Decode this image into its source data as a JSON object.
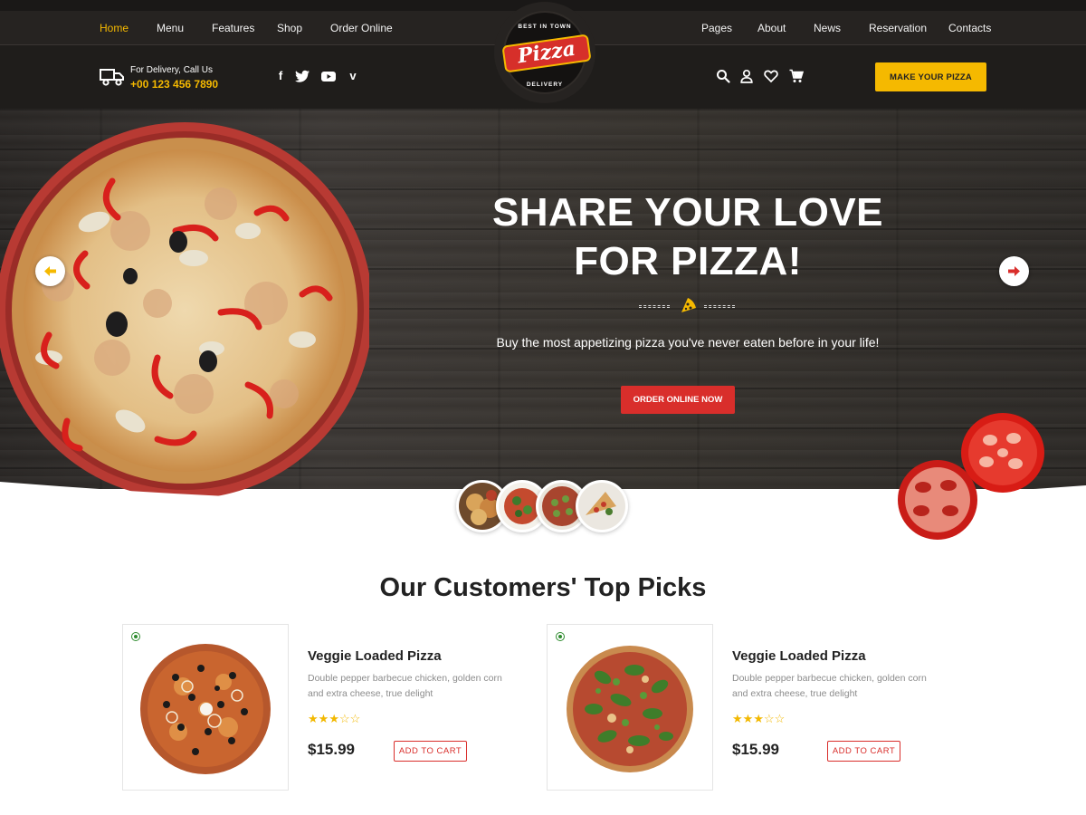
{
  "nav": {
    "left": [
      "Home",
      "Menu",
      "Features",
      "Shop",
      "Order Online"
    ],
    "right": [
      "Pages",
      "About",
      "News",
      "Reservation",
      "Contacts"
    ],
    "active": "Home"
  },
  "logo": {
    "top_text": "BEST IN TOWN",
    "word": "Pizza",
    "bottom_text": "DELIVERY"
  },
  "delivery": {
    "label": "For Delivery, Call Us",
    "phone": "+00 123 456 7890"
  },
  "social_icons": [
    "facebook-icon",
    "twitter-icon",
    "youtube-icon",
    "vimeo-icon"
  ],
  "header_icons": [
    "search-icon",
    "user-icon",
    "heart-icon",
    "cart-icon"
  ],
  "make_button": "MAKE YOUR PIZZA",
  "hero": {
    "title_line1": "SHARE YOUR LOVE",
    "title_line2": "FOR PIZZA!",
    "subtitle": "Buy the most appetizing pizza you've never eaten before in your life!",
    "button": "ORDER ONLINE NOW"
  },
  "section": {
    "title": "Our Customers' Top Picks"
  },
  "products": [
    {
      "name": "Veggie Loaded Pizza",
      "description": "Double pepper barbecue chicken, golden corn and extra cheese, true delight",
      "rating": 3,
      "rating_max": 5,
      "price": "$15.99",
      "button": "ADD TO CART"
    },
    {
      "name": "Veggie Loaded Pizza",
      "description": "Double pepper barbecue chicken, golden corn and extra cheese, true delight",
      "rating": 3,
      "rating_max": 5,
      "price": "$15.99",
      "button": "ADD TO CART"
    }
  ],
  "colors": {
    "accent_yellow": "#f5b900",
    "accent_red": "#d92e2b",
    "header_bg": "#262321",
    "veg_green": "#2e8b2e"
  }
}
